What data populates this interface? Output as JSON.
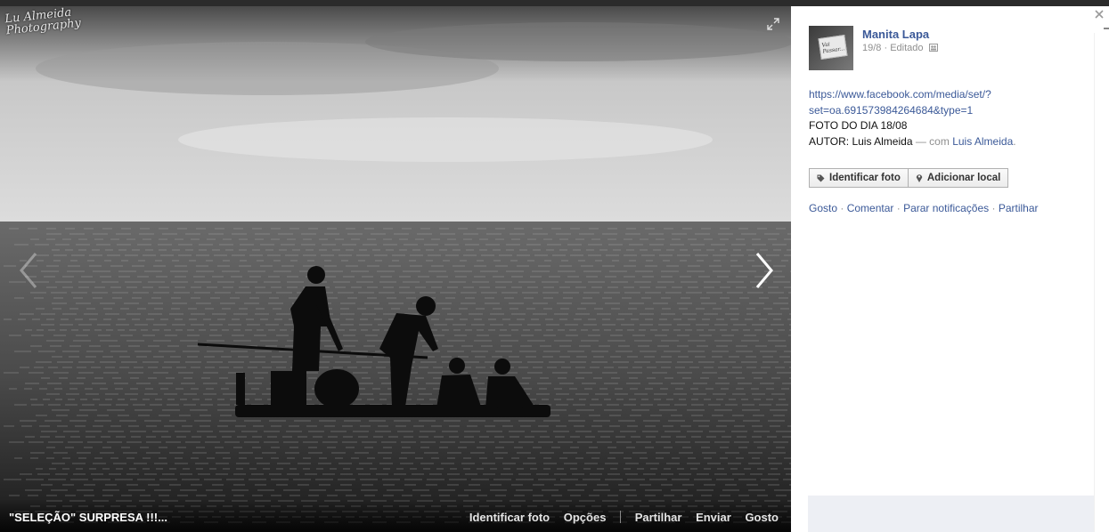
{
  "photo": {
    "watermark_line1": "Lu Almeida",
    "watermark_line2": "Photography",
    "caption": "\"SELEÇÃO\" SURPRESA !!!...",
    "bar_actions": {
      "tag": "Identificar foto",
      "options": "Opções",
      "share": "Partilhar",
      "send": "Enviar",
      "like": "Gosto"
    }
  },
  "sidebar": {
    "author": "Manita Lapa",
    "date": "19/8",
    "edited": "Editado",
    "avatar_text": "Vai Passar...",
    "link_line1": "https://www.facebook.com/media/set/?",
    "link_line2": "set=oa.691573984264684&type=1",
    "photo_of_day": "FOTO DO DIA 18/08",
    "author_prefix": "AUTOR: Luis Almeida",
    "with_text": "— com",
    "with_name": "Luis Almeida",
    "with_suffix": ".",
    "buttons": {
      "tag": "Identificar foto",
      "location": "Adicionar local"
    },
    "actions": {
      "like": "Gosto",
      "comment": "Comentar",
      "stop_notifications": "Parar notificações",
      "share": "Partilhar",
      "separator": "·"
    }
  },
  "colors": {
    "link": "#3b5998",
    "muted": "#8f8f8f",
    "sidebar_bg": "#ffffff"
  }
}
